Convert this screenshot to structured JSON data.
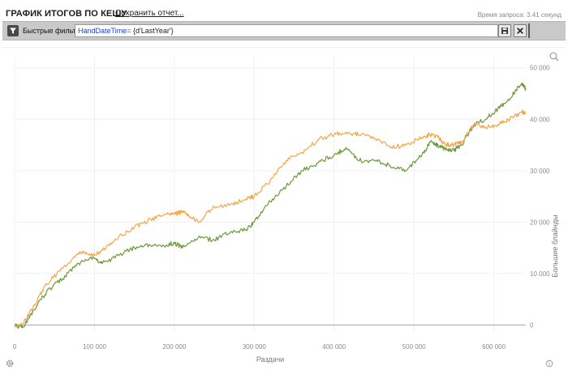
{
  "header": {
    "title": "ГРАФИК ИТОГОВ ПО КЕШУ",
    "save_link": "Сохранить отчет...",
    "query_time": "Время запроса: 3.41 секунд"
  },
  "filter": {
    "label": "Быстрые фильт",
    "expression_field": "HandDateTime",
    "expression_op": "= ",
    "expression_value": "{d'LastYear'}"
  },
  "icons": {
    "filter": "filter-icon",
    "save": "save-icon",
    "clear": "close-icon",
    "zoom": "zoom-icon",
    "settings": "gear-icon",
    "info": "info-icon"
  },
  "colors": {
    "green_series": "#6a9a3a",
    "orange_series": "#f5a64a",
    "zero_line": "#b3b3b3",
    "grid": "#f0f0f0"
  },
  "chart_data": {
    "type": "line",
    "xlabel": "Раздачи",
    "ylabel": "Большие блайнды",
    "xlim": [
      0,
      640000
    ],
    "ylim": [
      -1500,
      52000
    ],
    "x_ticks": [
      "0",
      "100 000",
      "200 000",
      "300 000",
      "400 000",
      "500 000",
      "600 000"
    ],
    "x_tick_values": [
      0,
      100000,
      200000,
      300000,
      400000,
      500000,
      600000
    ],
    "y_ticks": [
      "0",
      "10 000",
      "20 000",
      "30 000",
      "40 000",
      "50 000"
    ],
    "y_tick_values": [
      0,
      10000,
      20000,
      30000,
      40000,
      50000
    ],
    "series": [
      {
        "color": "#6a9a3a",
        "x": [
          0,
          10000,
          25000,
          40000,
          60000,
          80000,
          100000,
          110000,
          130000,
          150000,
          170000,
          190000,
          200000,
          210000,
          230000,
          250000,
          270000,
          290000,
          300000,
          320000,
          340000,
          360000,
          380000,
          400000,
          415000,
          430000,
          450000,
          470000,
          490000,
          510000,
          520000,
          530000,
          540000,
          550000,
          560000,
          575000,
          590000,
          605000,
          620000,
          635000,
          640000
        ],
        "y": [
          0,
          -500,
          3000,
          6500,
          9000,
          12000,
          13000,
          12000,
          13500,
          15000,
          15500,
          15500,
          16000,
          15000,
          17000,
          16500,
          18000,
          18500,
          20000,
          24000,
          27000,
          30000,
          31500,
          33000,
          34500,
          32000,
          32000,
          31000,
          30000,
          33000,
          35500,
          35000,
          34000,
          34000,
          35000,
          39000,
          40000,
          42000,
          44000,
          47000,
          46000
        ]
      },
      {
        "color": "#f5a64a",
        "x": [
          0,
          10000,
          25000,
          40000,
          60000,
          80000,
          90000,
          100000,
          110000,
          130000,
          150000,
          170000,
          190000,
          200000,
          210000,
          220000,
          230000,
          250000,
          270000,
          290000,
          300000,
          320000,
          340000,
          360000,
          380000,
          400000,
          415000,
          430000,
          450000,
          470000,
          490000,
          510000,
          520000,
          530000,
          540000,
          550000,
          560000,
          575000,
          590000,
          605000,
          620000,
          635000,
          640000
        ],
        "y": [
          0,
          0,
          4000,
          8000,
          11000,
          14000,
          14000,
          13500,
          14500,
          17000,
          19000,
          20500,
          21500,
          21500,
          22000,
          21000,
          20000,
          23000,
          23500,
          24500,
          25000,
          28000,
          32000,
          33500,
          36000,
          37000,
          37500,
          37000,
          36500,
          34500,
          35000,
          36500,
          37000,
          36500,
          35000,
          35000,
          35500,
          39000,
          38500,
          39000,
          40000,
          41500,
          41000
        ]
      }
    ]
  }
}
